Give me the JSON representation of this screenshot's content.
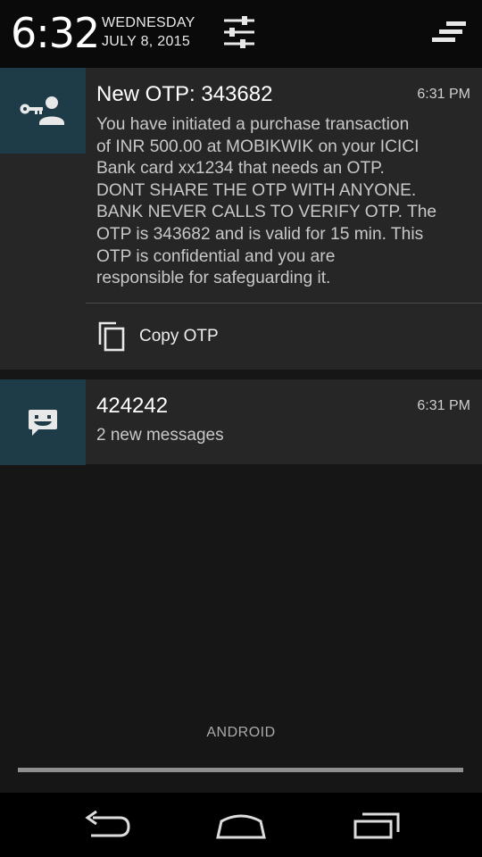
{
  "header": {
    "time": "6:32",
    "day": "WEDNESDAY",
    "date": "JULY 8, 2015",
    "quick_settings_icon": "sliders-icon",
    "clear_all_icon": "clear-all-icon"
  },
  "notifications": [
    {
      "icon": "key-person-icon",
      "title": "New OTP: 343682",
      "time": "6:31 PM",
      "body_lines": [
        "You have initiated a purchase transaction",
        "of INR 500.00 at MOBIKWIK on your ICICI",
        "Bank card xx1234 that needs an OTP.",
        "DONT SHARE THE OTP WITH ANYONE.",
        "BANK NEVER CALLS TO VERIFY OTP. The",
        "OTP is 343682 and is valid for 15 min. This",
        "OTP is confidential and you are",
        "responsible for safeguarding it."
      ],
      "action": {
        "icon": "copy-icon",
        "label": "Copy OTP"
      }
    },
    {
      "icon": "message-smiley-icon",
      "title": "424242",
      "time": "6:31 PM",
      "subtitle": "2 new messages"
    }
  ],
  "carrier_label": "ANDROID",
  "colors": {
    "icon_background": "#1e3b48",
    "notification_background": "#262626",
    "shade_background": "#161616"
  },
  "navbar": {
    "back_icon": "back-icon",
    "home_icon": "home-icon",
    "recents_icon": "recents-icon"
  }
}
